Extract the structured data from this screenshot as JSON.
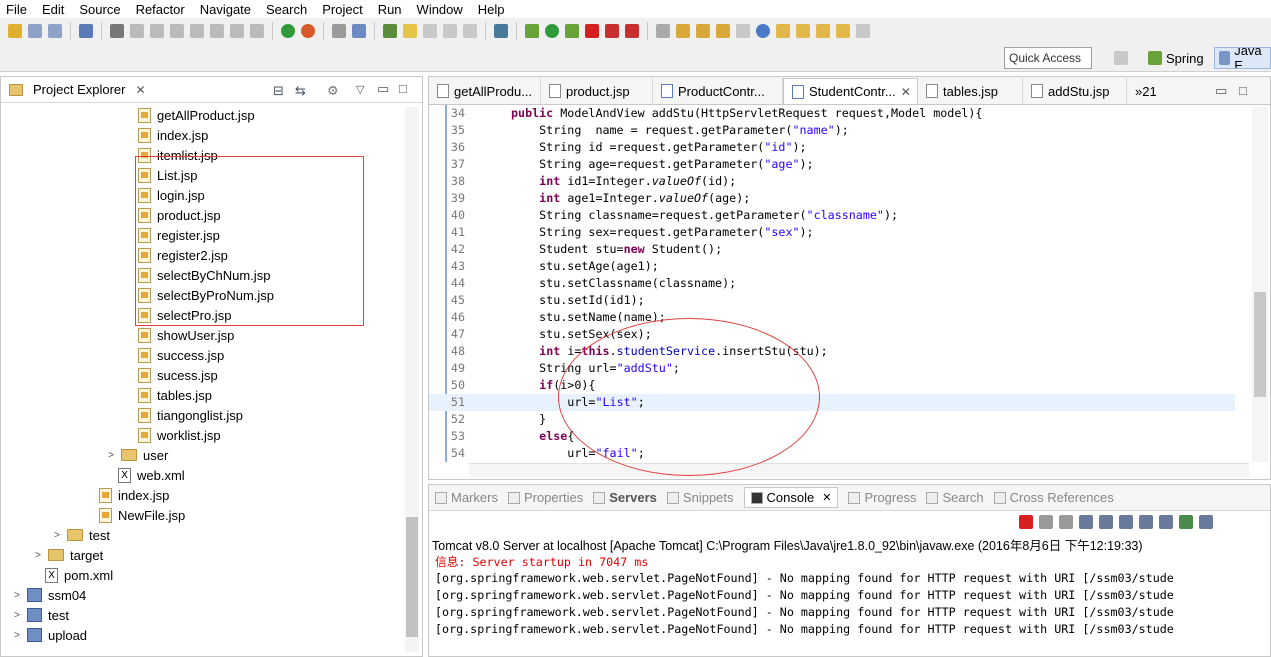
{
  "menu": [
    "File",
    "Edit",
    "Source",
    "Refactor",
    "Navigate",
    "Search",
    "Project",
    "Run",
    "Window",
    "Help"
  ],
  "quick_access": "Quick Access",
  "perspectives": [
    "Spring",
    "Java E"
  ],
  "explorer": {
    "title": "Project Explorer",
    "items": [
      {
        "label": "getAllProduct.jsp",
        "kind": "jsp"
      },
      {
        "label": "index.jsp",
        "kind": "jsp"
      },
      {
        "label": "itemlist.jsp",
        "kind": "jsp"
      },
      {
        "label": "List.jsp",
        "kind": "jsp"
      },
      {
        "label": "login.jsp",
        "kind": "jsp"
      },
      {
        "label": "product.jsp",
        "kind": "jsp"
      },
      {
        "label": "register.jsp",
        "kind": "jsp"
      },
      {
        "label": "register2.jsp",
        "kind": "jsp"
      },
      {
        "label": "selectByChNum.jsp",
        "kind": "jsp"
      },
      {
        "label": "selectByProNum.jsp",
        "kind": "jsp"
      },
      {
        "label": "selectPro.jsp",
        "kind": "jsp"
      },
      {
        "label": "showUser.jsp",
        "kind": "jsp"
      },
      {
        "label": "success.jsp",
        "kind": "jsp"
      },
      {
        "label": "sucess.jsp",
        "kind": "jsp"
      },
      {
        "label": "tables.jsp",
        "kind": "jsp"
      },
      {
        "label": "tiangonglist.jsp",
        "kind": "jsp"
      },
      {
        "label": "worklist.jsp",
        "kind": "jsp"
      },
      {
        "label": "user",
        "kind": "folder"
      },
      {
        "label": "web.xml",
        "kind": "xml"
      },
      {
        "label": "index.jsp",
        "kind": "jsp"
      },
      {
        "label": "NewFile.jsp",
        "kind": "jsp"
      },
      {
        "label": "test",
        "kind": "folder"
      },
      {
        "label": "target",
        "kind": "folder"
      },
      {
        "label": "pom.xml",
        "kind": "xml"
      },
      {
        "label": "ssm04",
        "kind": "project"
      },
      {
        "label": "test",
        "kind": "project"
      },
      {
        "label": "upload",
        "kind": "project"
      }
    ]
  },
  "editor": {
    "tabs": [
      "getAllProdu...",
      "product.jsp",
      "ProductContr...",
      "StudentContr...",
      "tables.jsp",
      "addStu.jsp"
    ],
    "overflow": "»21",
    "lines": [
      {
        "n": "34",
        "t": "    public ModelAndView addStu(HttpServletRequest request,Model model){"
      },
      {
        "n": "35",
        "t": "        String  name = request.getParameter(\"name\");"
      },
      {
        "n": "36",
        "t": "        String id =request.getParameter(\"id\");"
      },
      {
        "n": "37",
        "t": "        String age=request.getParameter(\"age\");"
      },
      {
        "n": "38",
        "t": "        int id1=Integer.valueOf(id);"
      },
      {
        "n": "39",
        "t": "        int age1=Integer.valueOf(age);"
      },
      {
        "n": "40",
        "t": "        String classname=request.getParameter(\"classname\");"
      },
      {
        "n": "41",
        "t": "        String sex=request.getParameter(\"sex\");"
      },
      {
        "n": "42",
        "t": "        Student stu=new Student();"
      },
      {
        "n": "43",
        "t": "        stu.setAge(age1);"
      },
      {
        "n": "44",
        "t": "        stu.setClassname(classname);"
      },
      {
        "n": "45",
        "t": "        stu.setId(id1);"
      },
      {
        "n": "46",
        "t": "        stu.setName(name);"
      },
      {
        "n": "47",
        "t": "        stu.setSex(sex);"
      },
      {
        "n": "48",
        "t": "        int i=this.studentService.insertStu(stu);"
      },
      {
        "n": "49",
        "t": "        String url=\"addStu\";"
      },
      {
        "n": "50",
        "t": "        if(i>0){"
      },
      {
        "n": "51",
        "t": "            url=\"List\";"
      },
      {
        "n": "52",
        "t": "        }"
      },
      {
        "n": "53",
        "t": "        else{"
      },
      {
        "n": "54",
        "t": "            url=\"fail\";"
      }
    ]
  },
  "bottom": {
    "tabs": [
      "Markers",
      "Properties",
      "Servers",
      "Snippets",
      "Console",
      "Progress",
      "Search",
      "Cross References"
    ],
    "active_tab": "Console",
    "console_title": "Tomcat v8.0 Server at localhost [Apache Tomcat] C:\\Program Files\\Java\\jre1.8.0_92\\bin\\javaw.exe (2016年8月6日 下午12:19:33)",
    "lines": [
      "信息: Server startup in 7047 ms",
      "[org.springframework.web.servlet.PageNotFound] - No mapping found for HTTP request with URI [/ssm03/stude",
      "[org.springframework.web.servlet.PageNotFound] - No mapping found for HTTP request with URI [/ssm03/stude",
      "[org.springframework.web.servlet.PageNotFound] - No mapping found for HTTP request with URI [/ssm03/stude",
      "[org.springframework.web.servlet.PageNotFound] - No mapping found for HTTP request with URI [/ssm03/stude"
    ]
  }
}
